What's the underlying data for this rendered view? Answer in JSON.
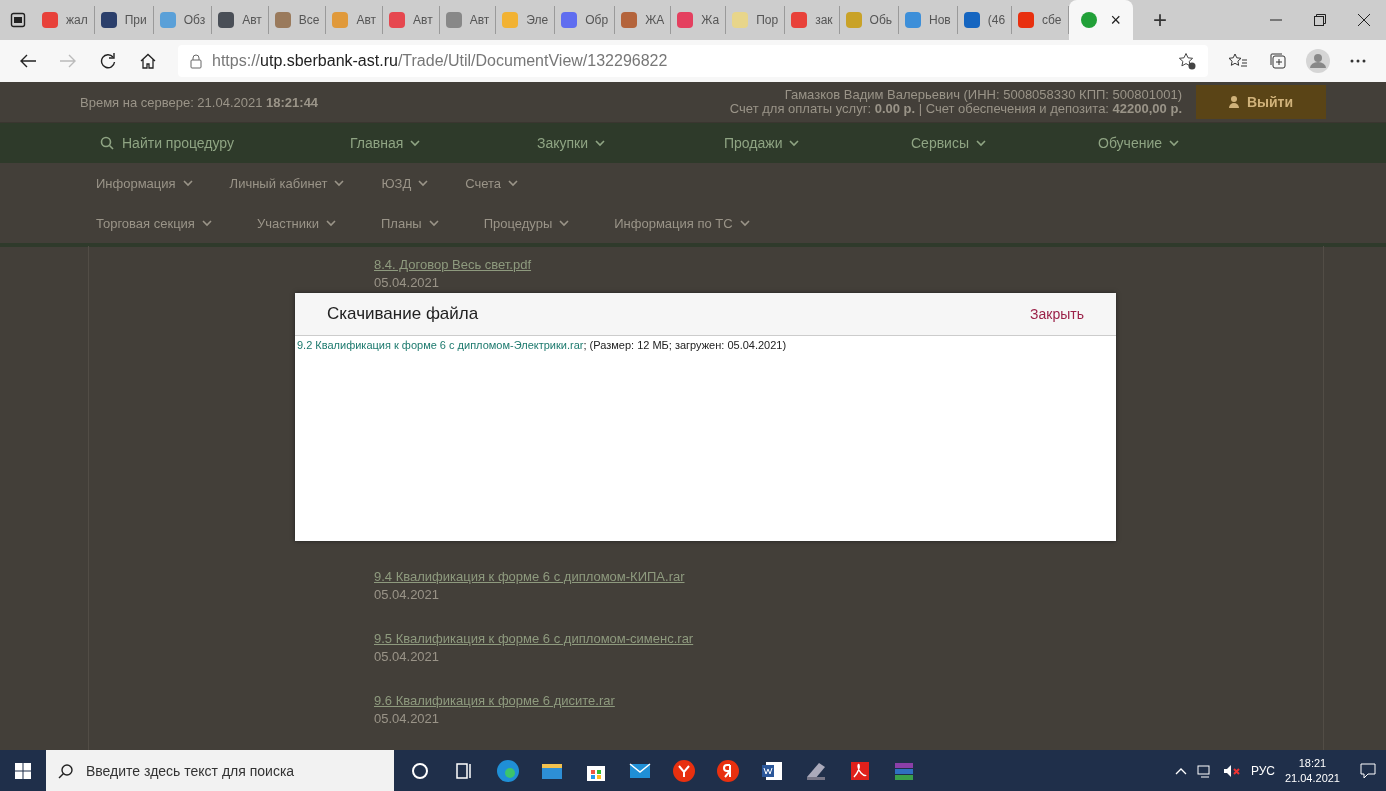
{
  "browser": {
    "tabs": [
      {
        "label": "жал",
        "color": "#e8413a",
        "selected": false
      },
      {
        "label": "При",
        "color": "#2b3f6b",
        "selected": false
      },
      {
        "label": "Обз",
        "color": "#5aa0d8",
        "selected": false
      },
      {
        "label": "Авт",
        "color": "#4a4f57",
        "selected": false
      },
      {
        "label": "Все",
        "color": "#9a7a5c",
        "selected": false
      },
      {
        "label": "Авт",
        "color": "#e0993a",
        "selected": false
      },
      {
        "label": "Авт",
        "color": "#e6474f",
        "selected": false
      },
      {
        "label": "Авт",
        "color": "#888888",
        "selected": false
      },
      {
        "label": "Эле",
        "color": "#f2b233",
        "selected": false
      },
      {
        "label": "Обр",
        "color": "#5f6df0",
        "selected": false
      },
      {
        "label": "ЖА",
        "color": "#b4643c",
        "selected": false
      },
      {
        "label": "Жа",
        "color": "#e4405f",
        "selected": false
      },
      {
        "label": "Пор",
        "color": "#e8d58a",
        "selected": false
      },
      {
        "label": "зак",
        "color": "#e8413a",
        "selected": false
      },
      {
        "label": "Обь",
        "color": "#c9a227",
        "selected": false
      },
      {
        "label": "Нов",
        "color": "#3d8fd9",
        "selected": false
      },
      {
        "label": "(46",
        "color": "#1565c0",
        "selected": false
      },
      {
        "label": "сбе",
        "color": "#e8300f",
        "selected": false
      },
      {
        "color": "#21a038",
        "selected": true
      }
    ],
    "close_tab": "×",
    "new_tab": "+",
    "url": {
      "domain": "utp.sberbank-ast.ru",
      "scheme": "https://",
      "path": "/Trade/Util/DocumentView/132296822"
    }
  },
  "header": {
    "server_time": "Время на сервере: 21.04.2021 **18:21:44**",
    "user": "Гамазков Вадим Валерьевич (ИНН: 5008058330 КПП: 500801001)",
    "accounts": "Счет для оплаты услуг: **0.00 р.** | Счет обеспечения и депозита: **42200,00 р.**",
    "logout": "Выйти"
  },
  "main_nav": {
    "search": "Найти процедуру",
    "items": [
      "Главная",
      "Закупки",
      "Продажи",
      "Сервисы",
      "Обучение"
    ]
  },
  "sub_nav_1": [
    "Информация",
    "Личный кабинет",
    "ЮЗД",
    "Счета"
  ],
  "sub_nav_2": [
    "Торговая секция",
    "Участники",
    "Планы",
    "Процедуры",
    "Информация по ТС"
  ],
  "documents": [
    {
      "name": "8.4. Договор Весь свет.pdf",
      "date": "05.04.2021"
    },
    {
      "name": "9.4 Квалификация к форме 6 с дипломом-КИПА.rar",
      "date": "05.04.2021"
    },
    {
      "name": "9.5 Квалификация к форме 6 с дипломом-сименс.rar",
      "date": "05.04.2021"
    },
    {
      "name": "9.6 Квалификация к форме 6 дисите.rar",
      "date": "05.04.2021"
    }
  ],
  "dialog": {
    "title": "Скачивание файла",
    "close": "Закрыть",
    "file_link": "9.2 Квалификация к форме 6 с дипломом-Электрики.rar",
    "file_info": "; (Размер: 12 МБ; загружен: 05.04.2021)"
  },
  "taskbar": {
    "search_placeholder": "Введите здесь текст для поиска",
    "language": "РУС",
    "time": "18:21",
    "date": "21.04.2021"
  }
}
